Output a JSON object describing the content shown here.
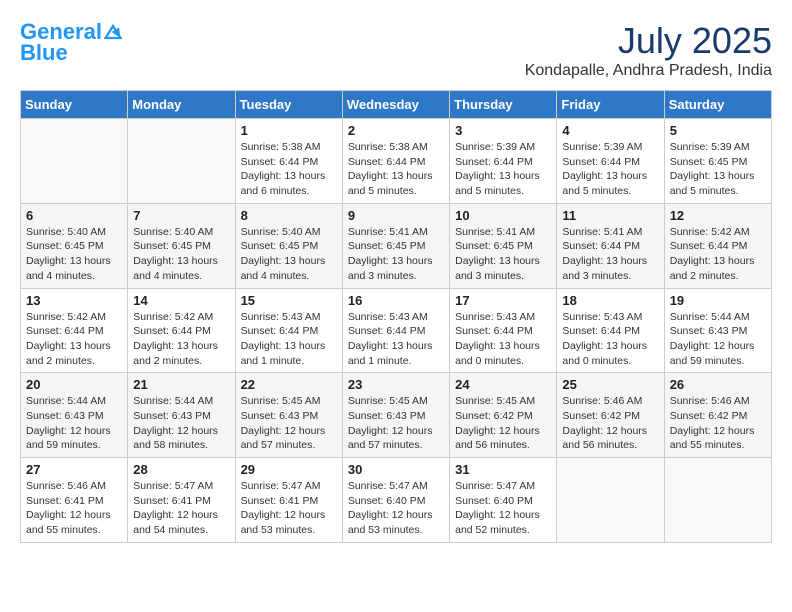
{
  "header": {
    "logo_line1": "General",
    "logo_line2": "Blue",
    "month_title": "July 2025",
    "location": "Kondapalle, Andhra Pradesh, India"
  },
  "weekdays": [
    "Sunday",
    "Monday",
    "Tuesday",
    "Wednesday",
    "Thursday",
    "Friday",
    "Saturday"
  ],
  "weeks": [
    [
      {
        "day": "",
        "info": ""
      },
      {
        "day": "",
        "info": ""
      },
      {
        "day": "1",
        "info": "Sunrise: 5:38 AM\nSunset: 6:44 PM\nDaylight: 13 hours and 6 minutes."
      },
      {
        "day": "2",
        "info": "Sunrise: 5:38 AM\nSunset: 6:44 PM\nDaylight: 13 hours and 5 minutes."
      },
      {
        "day": "3",
        "info": "Sunrise: 5:39 AM\nSunset: 6:44 PM\nDaylight: 13 hours and 5 minutes."
      },
      {
        "day": "4",
        "info": "Sunrise: 5:39 AM\nSunset: 6:44 PM\nDaylight: 13 hours and 5 minutes."
      },
      {
        "day": "5",
        "info": "Sunrise: 5:39 AM\nSunset: 6:45 PM\nDaylight: 13 hours and 5 minutes."
      }
    ],
    [
      {
        "day": "6",
        "info": "Sunrise: 5:40 AM\nSunset: 6:45 PM\nDaylight: 13 hours and 4 minutes."
      },
      {
        "day": "7",
        "info": "Sunrise: 5:40 AM\nSunset: 6:45 PM\nDaylight: 13 hours and 4 minutes."
      },
      {
        "day": "8",
        "info": "Sunrise: 5:40 AM\nSunset: 6:45 PM\nDaylight: 13 hours and 4 minutes."
      },
      {
        "day": "9",
        "info": "Sunrise: 5:41 AM\nSunset: 6:45 PM\nDaylight: 13 hours and 3 minutes."
      },
      {
        "day": "10",
        "info": "Sunrise: 5:41 AM\nSunset: 6:45 PM\nDaylight: 13 hours and 3 minutes."
      },
      {
        "day": "11",
        "info": "Sunrise: 5:41 AM\nSunset: 6:44 PM\nDaylight: 13 hours and 3 minutes."
      },
      {
        "day": "12",
        "info": "Sunrise: 5:42 AM\nSunset: 6:44 PM\nDaylight: 13 hours and 2 minutes."
      }
    ],
    [
      {
        "day": "13",
        "info": "Sunrise: 5:42 AM\nSunset: 6:44 PM\nDaylight: 13 hours and 2 minutes."
      },
      {
        "day": "14",
        "info": "Sunrise: 5:42 AM\nSunset: 6:44 PM\nDaylight: 13 hours and 2 minutes."
      },
      {
        "day": "15",
        "info": "Sunrise: 5:43 AM\nSunset: 6:44 PM\nDaylight: 13 hours and 1 minute."
      },
      {
        "day": "16",
        "info": "Sunrise: 5:43 AM\nSunset: 6:44 PM\nDaylight: 13 hours and 1 minute."
      },
      {
        "day": "17",
        "info": "Sunrise: 5:43 AM\nSunset: 6:44 PM\nDaylight: 13 hours and 0 minutes."
      },
      {
        "day": "18",
        "info": "Sunrise: 5:43 AM\nSunset: 6:44 PM\nDaylight: 13 hours and 0 minutes."
      },
      {
        "day": "19",
        "info": "Sunrise: 5:44 AM\nSunset: 6:43 PM\nDaylight: 12 hours and 59 minutes."
      }
    ],
    [
      {
        "day": "20",
        "info": "Sunrise: 5:44 AM\nSunset: 6:43 PM\nDaylight: 12 hours and 59 minutes."
      },
      {
        "day": "21",
        "info": "Sunrise: 5:44 AM\nSunset: 6:43 PM\nDaylight: 12 hours and 58 minutes."
      },
      {
        "day": "22",
        "info": "Sunrise: 5:45 AM\nSunset: 6:43 PM\nDaylight: 12 hours and 57 minutes."
      },
      {
        "day": "23",
        "info": "Sunrise: 5:45 AM\nSunset: 6:43 PM\nDaylight: 12 hours and 57 minutes."
      },
      {
        "day": "24",
        "info": "Sunrise: 5:45 AM\nSunset: 6:42 PM\nDaylight: 12 hours and 56 minutes."
      },
      {
        "day": "25",
        "info": "Sunrise: 5:46 AM\nSunset: 6:42 PM\nDaylight: 12 hours and 56 minutes."
      },
      {
        "day": "26",
        "info": "Sunrise: 5:46 AM\nSunset: 6:42 PM\nDaylight: 12 hours and 55 minutes."
      }
    ],
    [
      {
        "day": "27",
        "info": "Sunrise: 5:46 AM\nSunset: 6:41 PM\nDaylight: 12 hours and 55 minutes."
      },
      {
        "day": "28",
        "info": "Sunrise: 5:47 AM\nSunset: 6:41 PM\nDaylight: 12 hours and 54 minutes."
      },
      {
        "day": "29",
        "info": "Sunrise: 5:47 AM\nSunset: 6:41 PM\nDaylight: 12 hours and 53 minutes."
      },
      {
        "day": "30",
        "info": "Sunrise: 5:47 AM\nSunset: 6:40 PM\nDaylight: 12 hours and 53 minutes."
      },
      {
        "day": "31",
        "info": "Sunrise: 5:47 AM\nSunset: 6:40 PM\nDaylight: 12 hours and 52 minutes."
      },
      {
        "day": "",
        "info": ""
      },
      {
        "day": "",
        "info": ""
      }
    ]
  ]
}
